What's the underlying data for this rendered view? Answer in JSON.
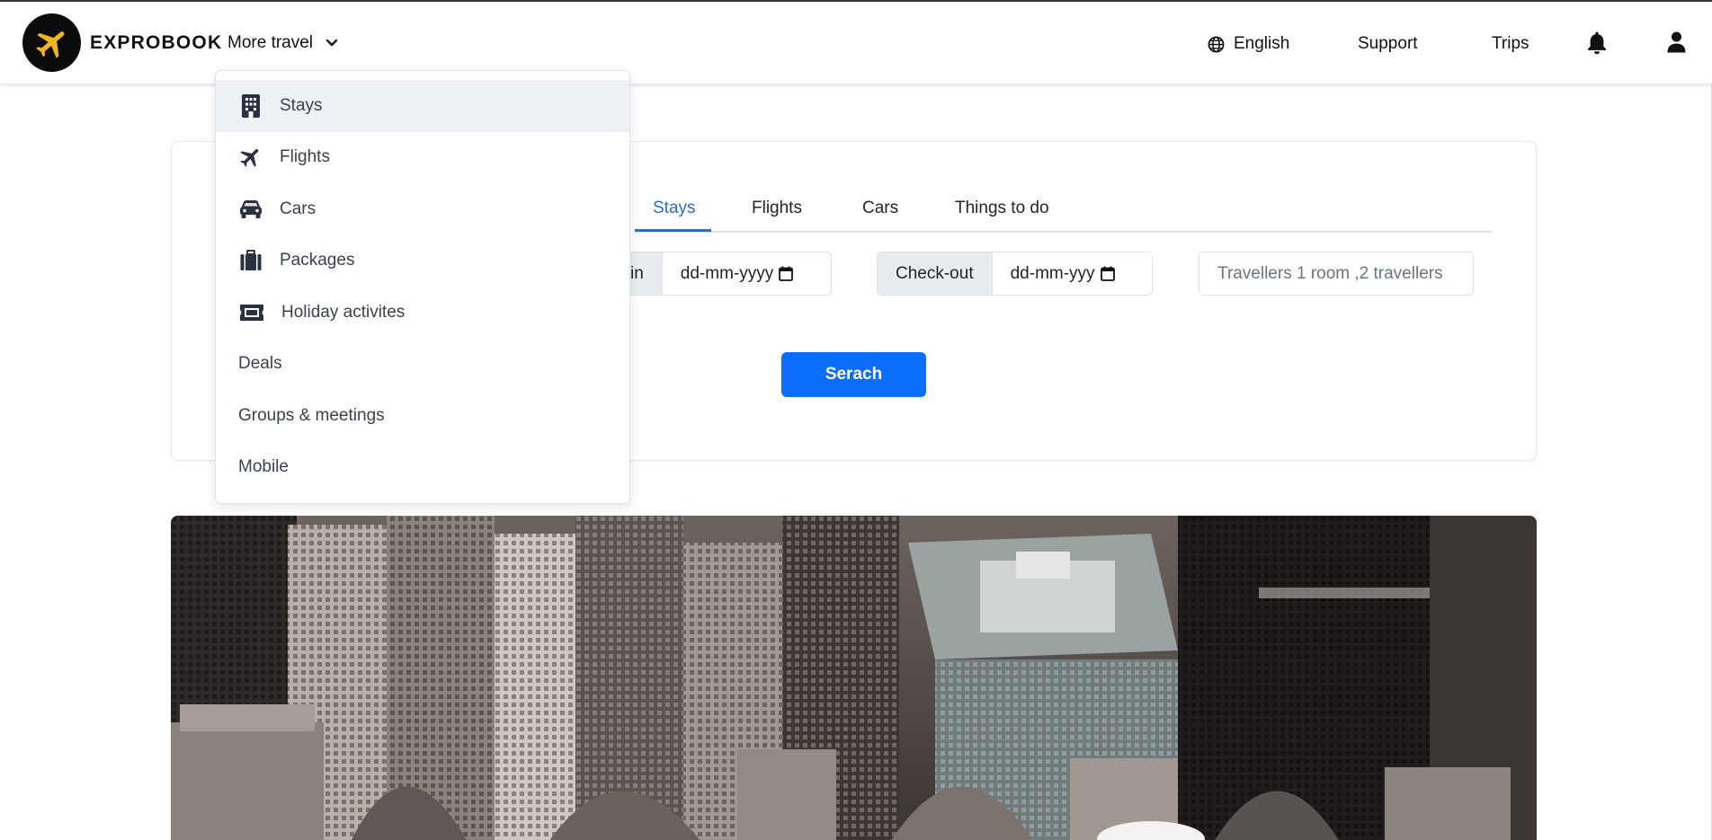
{
  "navbar": {
    "brand": "EXPROBOOK",
    "more_travel": "More travel",
    "language": "English",
    "support": "Support",
    "trips": "Trips"
  },
  "dropdown": {
    "items": [
      {
        "label": "Stays",
        "icon": "building-icon"
      },
      {
        "label": "Flights",
        "icon": "plane-icon"
      },
      {
        "label": "Cars",
        "icon": "car-icon"
      },
      {
        "label": "Packages",
        "icon": "suitcase-icon"
      },
      {
        "label": "Holiday activites",
        "icon": "ticket-icon"
      },
      {
        "label": "Deals",
        "icon": null
      },
      {
        "label": "Groups & meetings",
        "icon": null
      },
      {
        "label": "Mobile",
        "icon": null
      }
    ]
  },
  "search": {
    "tabs": [
      "Stays",
      "Flights",
      "Cars",
      "Things to do"
    ],
    "active_tab": "Stays",
    "checkin_label_partial": "in",
    "checkin_value": "dd-mm-yyyy",
    "checkout_label": "Check-out",
    "checkout_value": "dd-mm-yyy",
    "travellers_placeholder": "Travellers 1 room ,2 travellers",
    "search_button": "Serach"
  },
  "colors": {
    "accent": "#0d6efd",
    "tab_active": "#2f6fc3",
    "dropdown_active_bg": "#edf1f5"
  }
}
